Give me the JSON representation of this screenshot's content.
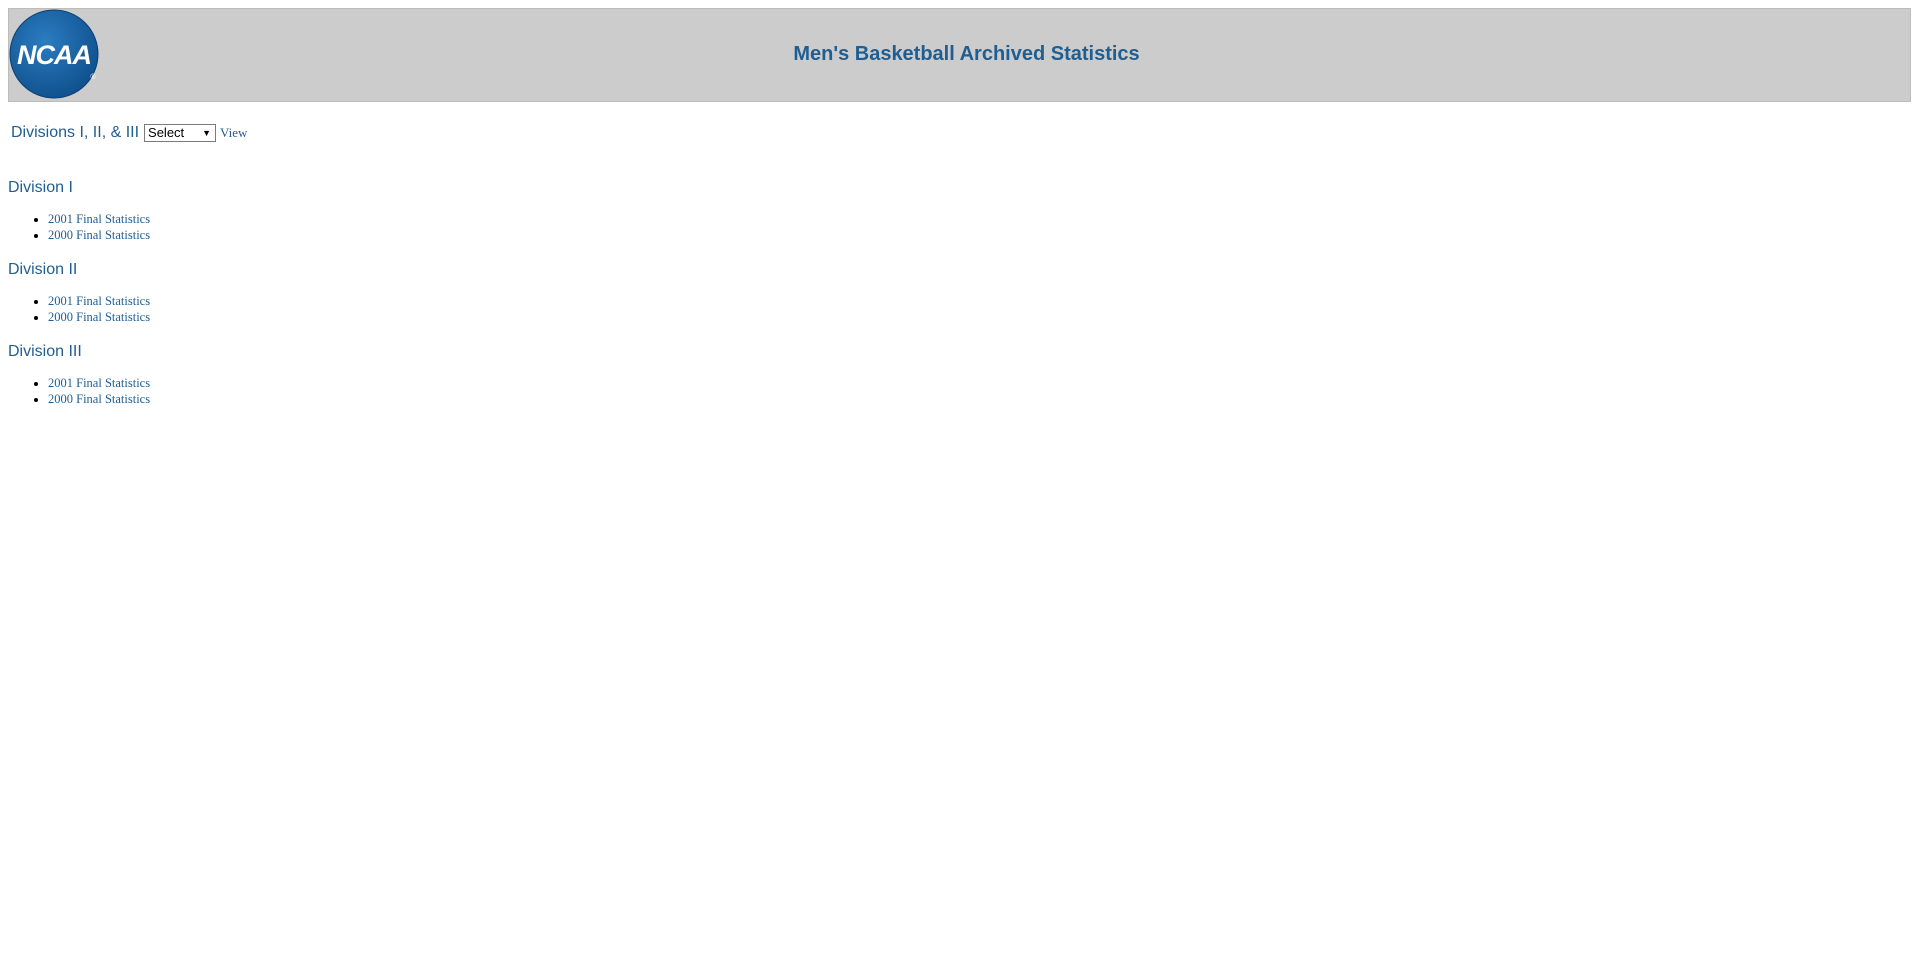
{
  "header": {
    "logo_text": "NCAA",
    "title": "Men's Basketball Archived Statistics"
  },
  "selector": {
    "label": "Divisions I, II, & III",
    "selected_option": "Select",
    "view_link": "View"
  },
  "divisions": [
    {
      "heading": "Division I",
      "links": [
        "2001 Final Statistics",
        "2000 Final Statistics"
      ]
    },
    {
      "heading": "Division II",
      "links": [
        "2001 Final Statistics",
        "2000 Final Statistics"
      ]
    },
    {
      "heading": "Division III",
      "links": [
        "2001 Final Statistics",
        "2000 Final Statistics"
      ]
    }
  ],
  "colors": {
    "link": "#1f5e92",
    "header_bg": "#cccccc",
    "logo_blue": "#1f64a3"
  }
}
